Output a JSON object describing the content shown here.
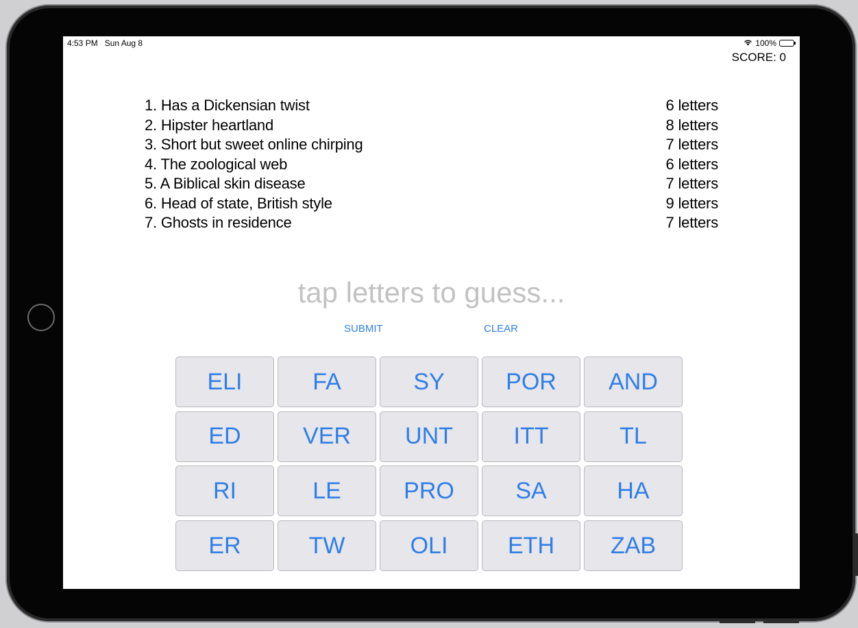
{
  "status_bar": {
    "time": "4:53 PM",
    "date": "Sun Aug 8",
    "battery": "100%"
  },
  "score": "SCORE: 0",
  "clues": [
    {
      "text": "1. Has a Dickensian twist",
      "length": "6 letters"
    },
    {
      "text": "2. Hipster heartland",
      "length": "8 letters"
    },
    {
      "text": "3. Short but sweet online chirping",
      "length": "7 letters"
    },
    {
      "text": "4. The zoological web",
      "length": "6 letters"
    },
    {
      "text": "5. A Biblical skin disease",
      "length": "7 letters"
    },
    {
      "text": "6. Head of state, British style",
      "length": "9 letters"
    },
    {
      "text": "7. Ghosts in residence",
      "length": "7 letters"
    }
  ],
  "guess_placeholder": "tap letters to guess...",
  "actions": {
    "submit": "SUBMIT",
    "clear": "CLEAR"
  },
  "tiles": [
    "ELI",
    "FA",
    "SY",
    "POR",
    "AND",
    "ED",
    "VER",
    "UNT",
    "ITT",
    "TL",
    "RI",
    "LE",
    "PRO",
    "SA",
    "HA",
    "ER",
    "TW",
    "OLI",
    "ETH",
    "ZAB"
  ],
  "colors": {
    "accent": "#2f7ee8",
    "tile_bg": "#e6e6eb",
    "placeholder": "#c2c2c4"
  }
}
